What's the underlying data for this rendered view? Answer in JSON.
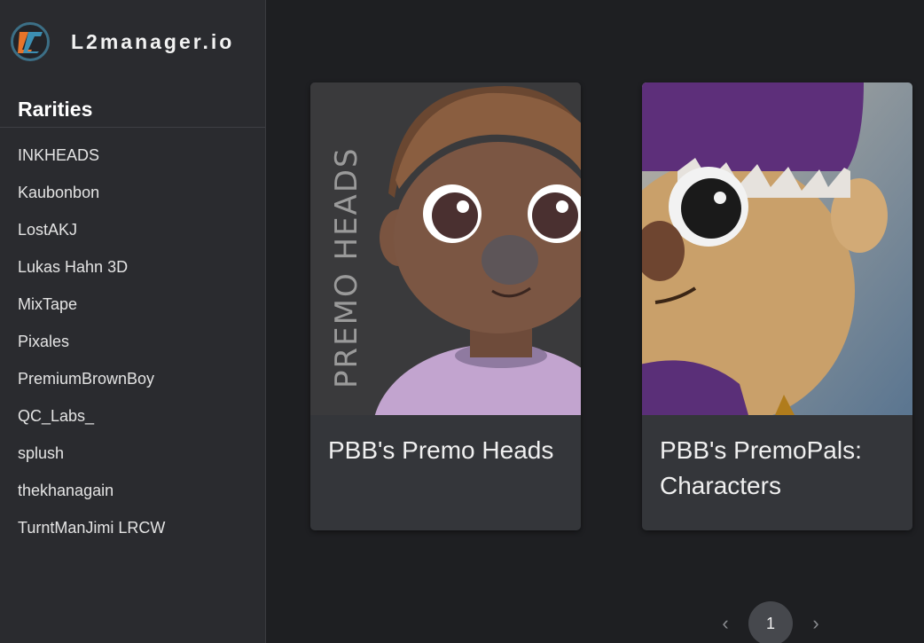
{
  "brand": {
    "name": "L2manager.io",
    "logo_icon": "l2-logo-icon"
  },
  "sidebar": {
    "section_title": "Rarities",
    "items": [
      {
        "label": "INKHEADS"
      },
      {
        "label": "Kaubonbon"
      },
      {
        "label": "LostAKJ"
      },
      {
        "label": "Lukas Hahn 3D"
      },
      {
        "label": "MixTape"
      },
      {
        "label": "Pixales"
      },
      {
        "label": "PremiumBrownBoy"
      },
      {
        "label": "QC_Labs_"
      },
      {
        "label": "splush"
      },
      {
        "label": "thekhanagain"
      },
      {
        "label": "TurntManJimi LRCW"
      }
    ]
  },
  "collections": [
    {
      "title": "PBB's Premo Heads",
      "image_text": "PREMO HEADS",
      "image_icon": "premo-heads-character-image"
    },
    {
      "title": "PBB's PremoPals: Characters",
      "image_icon": "premopals-character-image"
    }
  ],
  "pagination": {
    "current_page": "1",
    "prev_icon": "chevron-left-icon",
    "next_icon": "chevron-right-icon"
  },
  "colors": {
    "background": "#1e1f22",
    "sidebar": "#2a2b2f",
    "card": "#34363a",
    "logo_orange": "#e8742a",
    "logo_blue": "#3c8fb3"
  }
}
